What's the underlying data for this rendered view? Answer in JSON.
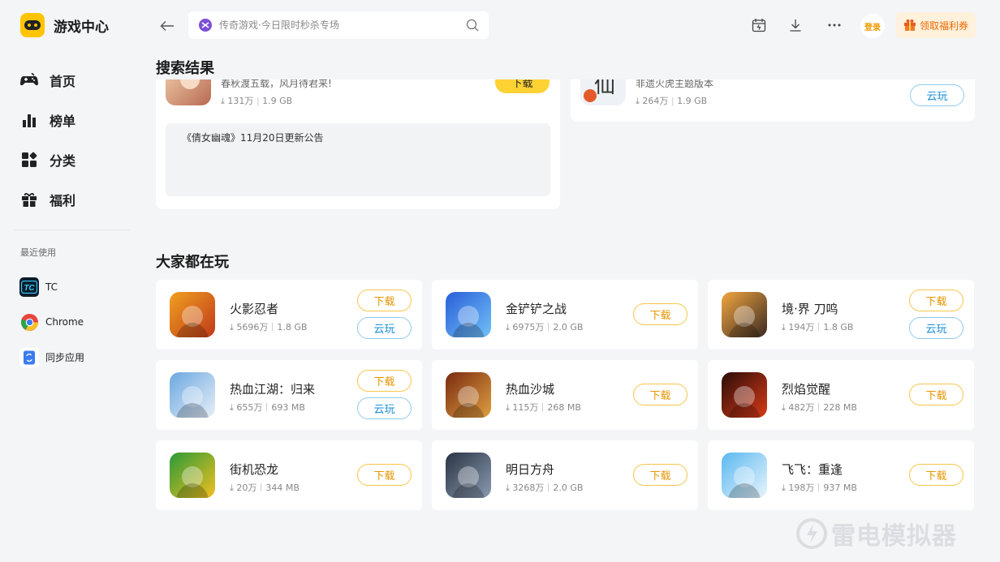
{
  "app": {
    "title": "游戏中心"
  },
  "sidebar": {
    "nav": [
      {
        "label": "首页",
        "icon": "gamepad-icon"
      },
      {
        "label": "榜单",
        "icon": "ranking-icon"
      },
      {
        "label": "分类",
        "icon": "category-icon"
      },
      {
        "label": "福利",
        "icon": "gift-icon"
      }
    ],
    "recent_title": "最近使用",
    "recent": [
      {
        "label": "TC",
        "icon": "tc-app-icon"
      },
      {
        "label": "Chrome",
        "icon": "chrome-icon"
      },
      {
        "label": "同步应用",
        "icon": "sync-app-icon"
      }
    ]
  },
  "topbar": {
    "search_placeholder": "传奇游戏·今日限时秒杀专场",
    "login_label": "登录",
    "coupon_label": "领取福利券"
  },
  "search_results": {
    "title": "搜索结果",
    "left": {
      "desc": "春秋渡五载，风月待君来!",
      "downloads": "131万",
      "size": "1.9 GB",
      "button": "下载",
      "notice": "《倩女幽魂》11月20日更新公告"
    },
    "right": {
      "desc": "非遗火虎主题版本",
      "downloads": "264万",
      "size": "1.9 GB",
      "button": "云玩"
    }
  },
  "popular": {
    "title": "大家都在玩",
    "download_label": "下载",
    "cloud_label": "云玩",
    "games": [
      {
        "name": "火影忍者",
        "downloads": "5696万",
        "size": "1.8 GB",
        "cloud": true,
        "colors": [
          "#f0a020",
          "#c0391a"
        ]
      },
      {
        "name": "金铲铲之战",
        "downloads": "6975万",
        "size": "2.0 GB",
        "cloud": false,
        "colors": [
          "#2a5fd8",
          "#70c0f8"
        ]
      },
      {
        "name": "境·界 刀鸣",
        "downloads": "194万",
        "size": "1.8 GB",
        "cloud": true,
        "colors": [
          "#f2a640",
          "#3a2a22"
        ]
      },
      {
        "name": "热血江湖：归来",
        "downloads": "655万",
        "size": "693 MB",
        "cloud": true,
        "colors": [
          "#6aa8e0",
          "#e8eef8"
        ]
      },
      {
        "name": "热血沙城",
        "downloads": "115万",
        "size": "268 MB",
        "cloud": false,
        "colors": [
          "#7a2a10",
          "#e0a040"
        ]
      },
      {
        "name": "烈焰觉醒",
        "downloads": "482万",
        "size": "228 MB",
        "cloud": false,
        "colors": [
          "#2a0c08",
          "#d83a18"
        ]
      },
      {
        "name": "街机恐龙",
        "downloads": "20万",
        "size": "344 MB",
        "cloud": false,
        "colors": [
          "#2a9a38",
          "#f2c020"
        ]
      },
      {
        "name": "明日方舟",
        "downloads": "3268万",
        "size": "2.0 GB",
        "cloud": false,
        "colors": [
          "#2a3444",
          "#8a9ab0"
        ]
      },
      {
        "name": "飞飞：重逢",
        "downloads": "198万",
        "size": "937 MB",
        "cloud": false,
        "colors": [
          "#5ab8f0",
          "#e8f4fc"
        ]
      }
    ]
  },
  "watermark": "雷电模拟器"
}
